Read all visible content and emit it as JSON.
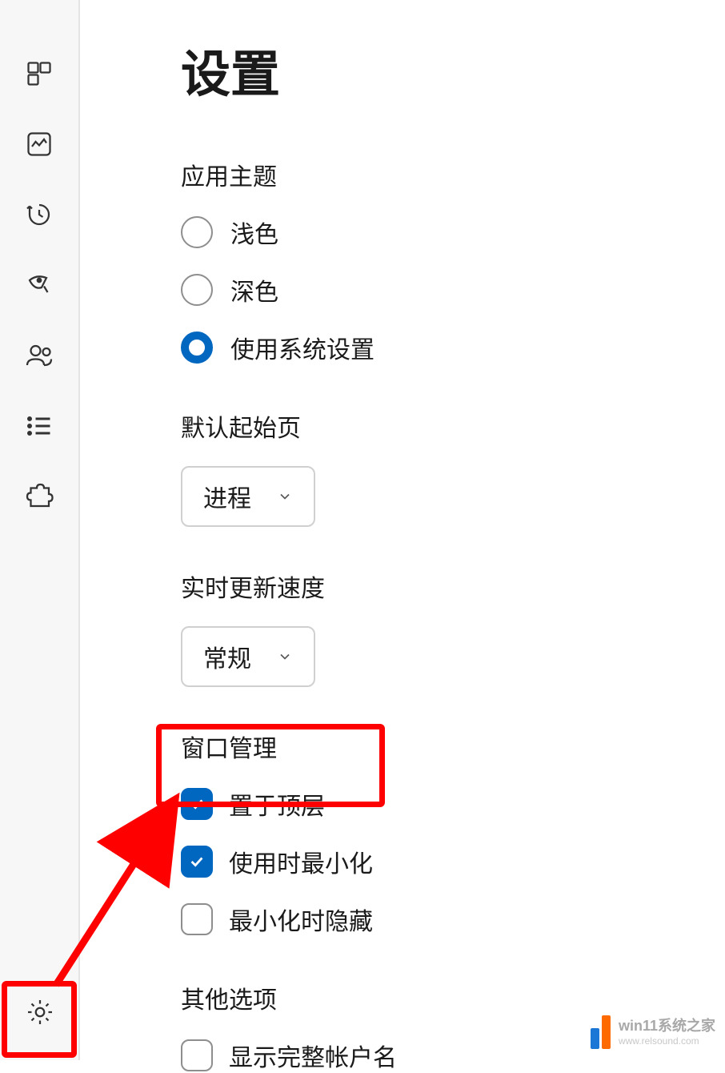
{
  "page_title": "设置",
  "sections": {
    "theme": {
      "title": "应用主题",
      "options": {
        "light": "浅色",
        "dark": "深色",
        "system": "使用系统设置"
      },
      "selected": "system"
    },
    "default_page": {
      "title": "默认起始页",
      "value": "进程"
    },
    "update_speed": {
      "title": "实时更新速度",
      "value": "常规"
    },
    "window_management": {
      "title": "窗口管理",
      "options": {
        "always_on_top": {
          "label": "置于顶层",
          "checked": true
        },
        "minimize_on_use": {
          "label": "使用时最小化",
          "checked": true
        },
        "hide_when_minimized": {
          "label": "最小化时隐藏",
          "checked": false
        }
      }
    },
    "other_options": {
      "title": "其他选项",
      "options": {
        "show_full_account_name": {
          "label": "显示完整帐户名",
          "checked": false
        }
      }
    }
  },
  "watermark": {
    "title": "win11系统之家",
    "url": "www.relsound.com"
  }
}
